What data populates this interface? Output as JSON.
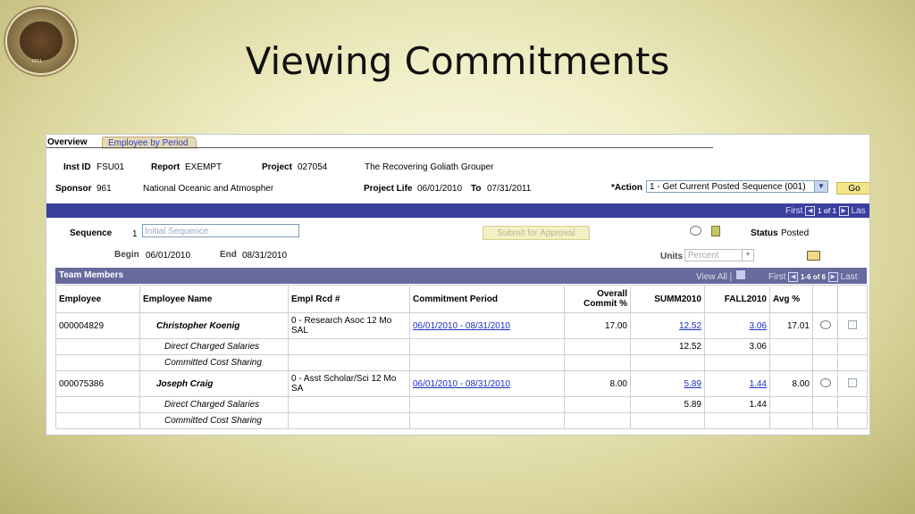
{
  "slide": {
    "title": "Viewing Commitments"
  },
  "seal": {
    "year": "1851"
  },
  "tabs": [
    {
      "label": "Overview"
    },
    {
      "label": "Employee by Period"
    }
  ],
  "header": {
    "inst_id_label": "Inst ID",
    "inst_id": "FSU01",
    "report_label": "Report",
    "report": "EXEMPT",
    "project_label": "Project",
    "project": "027054",
    "project_desc": "The Recovering Goliath Grouper",
    "sponsor_label": "Sponsor",
    "sponsor": "961",
    "sponsor_name": "National Oceanic and Atmospher",
    "project_life_label": "Project Life",
    "project_life_start": "06/01/2010",
    "to_label": "To",
    "project_life_end": "07/31/2011",
    "action_label": "*Action",
    "action_value": "1 - Get Current Posted Sequence (001)",
    "go_label": "Go"
  },
  "nav": {
    "first": "First",
    "count": "1 of 1",
    "last": "Las"
  },
  "sequence": {
    "label": "Sequence",
    "value": "1",
    "placeholder": "Initial Sequence",
    "submit_label": "Submit for Approval",
    "status_label": "Status",
    "status_value": "Posted",
    "begin_label": "Begin",
    "begin_value": "06/01/2010",
    "end_label": "End",
    "end_value": "08/31/2010",
    "units_label": "Units",
    "units_value": "Percent"
  },
  "team": {
    "title": "Team Members",
    "view_all": "View All |",
    "first": "First",
    "count": "1-6 of 6",
    "last": "Last",
    "columns": [
      "Employee",
      "Employee Name",
      "Empl Rcd #",
      "Commitment Period",
      "Overall Commit %",
      "SUMM2010",
      "FALL2010",
      "Avg %"
    ],
    "rows": [
      {
        "employee": "000004829",
        "name": "Christopher Koenig",
        "rcd": "0 - Research Asoc   12 Mo SAL",
        "period": "06/01/2010 - 08/31/2010",
        "overall": "17.00",
        "summ": "12.52",
        "fall": "3.06",
        "avg": "17.01"
      },
      {
        "sub": "Direct Charged Salaries",
        "summ": "12.52",
        "fall": "3.06"
      },
      {
        "sub": "Committed Cost Sharing"
      },
      {
        "employee": "000075386",
        "name": "Joseph Craig",
        "rcd": "0 - Asst Scholar/Sci  12 Mo SA",
        "period": "06/01/2010 - 08/31/2010",
        "overall": "8.00",
        "summ": "5.89",
        "fall": "1.44",
        "avg": "8.00"
      },
      {
        "sub": "Direct Charged Salaries",
        "summ": "5.89",
        "fall": "1.44"
      },
      {
        "sub": "Committed Cost Sharing"
      }
    ]
  },
  "icons": [
    "university-seal-icon",
    "comment-icon",
    "notes-icon",
    "folder-icon",
    "grid-icon",
    "first-arrow-icon",
    "next-arrow-icon",
    "dropdown-arrow-icon"
  ]
}
